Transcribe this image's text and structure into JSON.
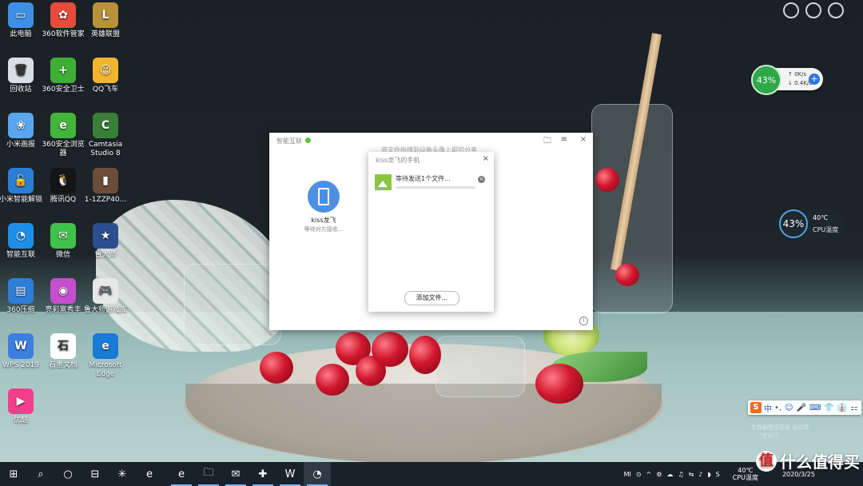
{
  "desktop_icons": [
    {
      "label": "此电脑",
      "color": "#3f8fe6",
      "glyph": "▭"
    },
    {
      "label": "360软件管家",
      "color": "#e84a3c",
      "glyph": "✿"
    },
    {
      "label": "英雄联盟",
      "color": "#b8923a",
      "glyph": "L"
    },
    {
      "label": "回收站",
      "color": "#d8e0e6",
      "glyph": "🗑"
    },
    {
      "label": "360安全卫士",
      "color": "#3fae35",
      "glyph": "+"
    },
    {
      "label": "QQ飞车",
      "color": "#f3b430",
      "glyph": "☺"
    },
    {
      "label": "小米画报",
      "color": "#59a6f0",
      "glyph": "❀"
    },
    {
      "label": "360安全浏览器",
      "color": "#43b53b",
      "glyph": "e"
    },
    {
      "label": "Camtasia Studio 8",
      "color": "#3a7e3a",
      "glyph": "C"
    },
    {
      "label": "小米智能解锁",
      "color": "#2a7fd5",
      "glyph": "🔓"
    },
    {
      "label": "腾讯QQ",
      "color": "#151515",
      "glyph": "🐧"
    },
    {
      "label": "1-1ZZP40...",
      "color": "#6b4d3a",
      "glyph": "▮"
    },
    {
      "label": "智能互联",
      "color": "#1e8fe8",
      "glyph": "◔"
    },
    {
      "label": "微信",
      "color": "#3fc24a",
      "glyph": "✉"
    },
    {
      "label": "鲁大师",
      "color": "#2b4f8e",
      "glyph": "★"
    },
    {
      "label": "360压缩",
      "color": "#2d7ed6",
      "glyph": "▤"
    },
    {
      "label": "亮彩富秀丰",
      "color": "#c64fd0",
      "glyph": "◉"
    },
    {
      "label": "鲁大师游戏库",
      "color": "#e8e8e8",
      "glyph": "🎮"
    },
    {
      "label": "WPS 2019",
      "color": "#3c7fe0",
      "glyph": "W"
    },
    {
      "label": "石墨文档",
      "color": "#ffffff",
      "glyph": "石"
    },
    {
      "label": "Microsoft Edge",
      "color": "#1a7bd6",
      "glyph": "e"
    },
    {
      "label": "优酷",
      "color": "#f23e8c",
      "glyph": "▶"
    }
  ],
  "net_widget": {
    "percent": "43%",
    "up": "0K/s",
    "down": "0.4K/s",
    "plus": "+"
  },
  "cpu_widget": {
    "percent": "43%",
    "temp": "40℃",
    "label": "CPU温度"
  },
  "main_window": {
    "title": "智能互联",
    "hint": "将文件拖拽到设备头像上即可分享",
    "device_name": "kiss龙飞",
    "device_status": "等待对方接收...",
    "icons": {
      "folder": "🗀",
      "menu": "≡",
      "close": "×",
      "info": "i"
    }
  },
  "transfer_dialog": {
    "title": "kiss龙飞的手机",
    "close": "×",
    "file_status": "等待发送1个文件...",
    "progress": 0.0,
    "add_button": "添加文件..."
  },
  "ime": {
    "logo": "S",
    "mode": "中",
    "glyphs": [
      "•,",
      "☺",
      "🎤",
      "⌨",
      "👕",
      "👔",
      "⚏"
    ]
  },
  "ghost_notice": {
    "line1": "在数据模组更新 自动清",
    "line2": "\"…\"在运行"
  },
  "taskbar": {
    "buttons": [
      "⊞",
      "⌕",
      "○",
      "⊟",
      "✳",
      "e",
      "e",
      "🗀",
      "✉",
      "✚",
      "W",
      "◔"
    ],
    "cpu_temp": "40℃",
    "cpu_label": "CPU温度",
    "date": "2020/3/25",
    "tray_icons": [
      "MI",
      "⊙",
      "^",
      "⚙",
      "☁",
      "♫",
      "⇆",
      "♪",
      "◗",
      "S"
    ]
  },
  "watermark": "什么值得买"
}
